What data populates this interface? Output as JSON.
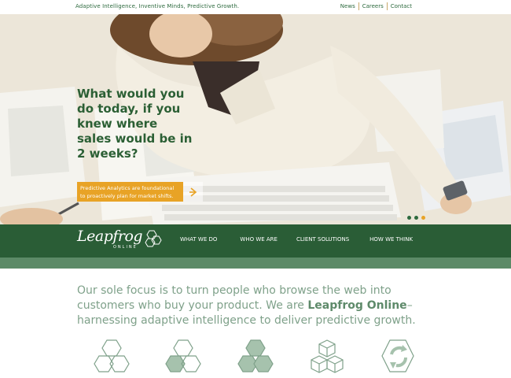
{
  "topbar": {
    "tagline": "Adaptive Intelligence, Inventive Minds, Predictive Growth.",
    "links": [
      "News",
      "Careers",
      "Contact"
    ]
  },
  "hero": {
    "headline": "What would you do today, if you knew where sales would be in 2 weeks?",
    "cta_text": "Predictive Analytics are foundational to proactively plan for market shifts.",
    "slide_count": 3,
    "active_slide": 3
  },
  "brand": {
    "logo_word": "Leapfrog",
    "logo_sub": "ONLINE"
  },
  "nav": {
    "items": [
      "WHAT WE DO",
      "WHO WE ARE",
      "CLIENT SOLUTIONS",
      "HOW WE THINK"
    ]
  },
  "intro": {
    "before": "Our sole focus is to turn people who browse the web into customers who buy your product. We are ",
    "brand": "Leapfrog Online",
    "after": "– harnessing adaptive intelligence to deliver predictive growth."
  },
  "colors": {
    "brand_green": "#2a5d36",
    "accent_orange": "#e8a326",
    "text_green": "#7fa18a"
  },
  "icons": [
    "hexagon-cluster-outline-icon",
    "hexagon-cluster-half-filled-icon",
    "hexagon-cluster-filled-icon",
    "cube-stack-icon",
    "recycle-hexagon-icon"
  ]
}
